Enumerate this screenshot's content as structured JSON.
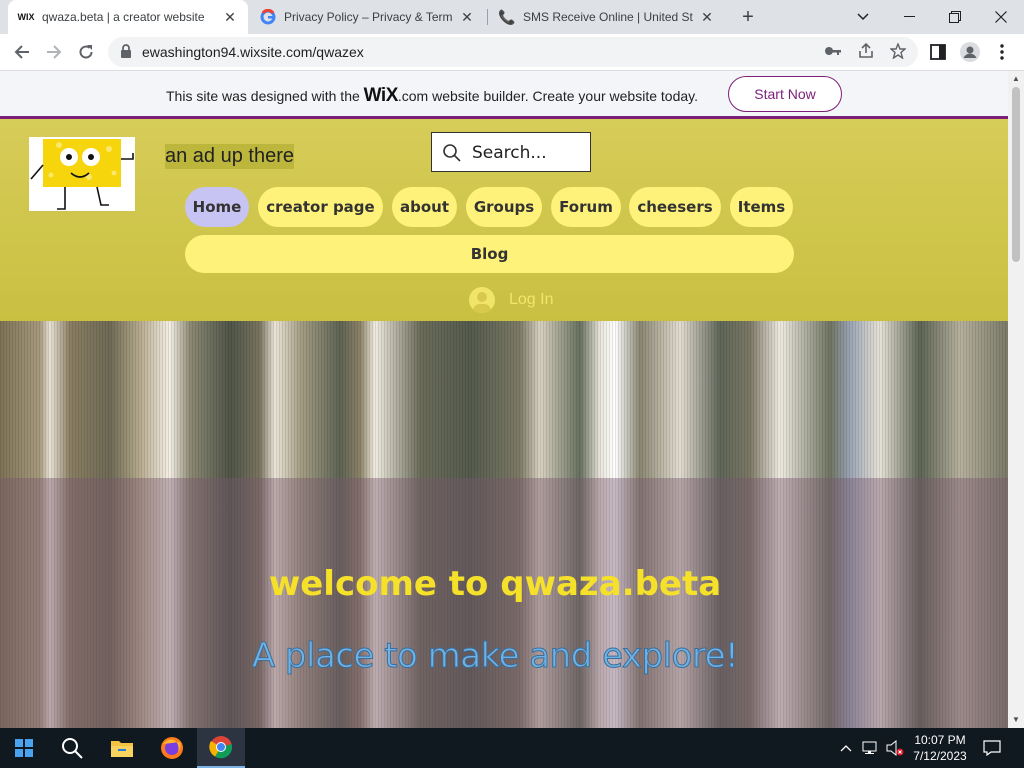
{
  "browser": {
    "tabs": [
      {
        "title": "qwaza.beta | a creator website",
        "favicon": "wix-favicon",
        "active": true
      },
      {
        "title": "Privacy Policy – Privacy & Terms –",
        "favicon": "google-favicon",
        "active": false
      },
      {
        "title": "SMS Receive Online | United Stat",
        "favicon": "phone-favicon",
        "active": false
      }
    ],
    "address": "ewashington94.wixsite.com/qwazex"
  },
  "wix_banner": {
    "text_before": "This site was designed with the",
    "logo_main": "WiX",
    "logo_suffix": ".com",
    "text_after": "website builder. Create your website today.",
    "cta": "Start Now"
  },
  "header": {
    "ad_text": "an ad up there",
    "search_placeholder": "Search...",
    "nav": [
      {
        "label": "Home",
        "active": true
      },
      {
        "label": "creator page"
      },
      {
        "label": "about"
      },
      {
        "label": "Groups"
      },
      {
        "label": "Forum"
      },
      {
        "label": "cheesers"
      },
      {
        "label": "Items"
      }
    ],
    "blog": "Blog",
    "login": "Log In"
  },
  "hero": {
    "title": "welcome to qwaza.beta",
    "subtitle": "A place to make and explore!"
  },
  "taskbar": {
    "time": "10:07 PM",
    "date": "7/12/2023"
  },
  "colors": {
    "wix_accent": "#7b1f78",
    "header_bg": "#d0c74d",
    "nav_pill": "#fff27a",
    "nav_active": "#c7c3f2",
    "hero_title": "#f5e12a",
    "hero_subtitle": "#6fb2e6"
  }
}
